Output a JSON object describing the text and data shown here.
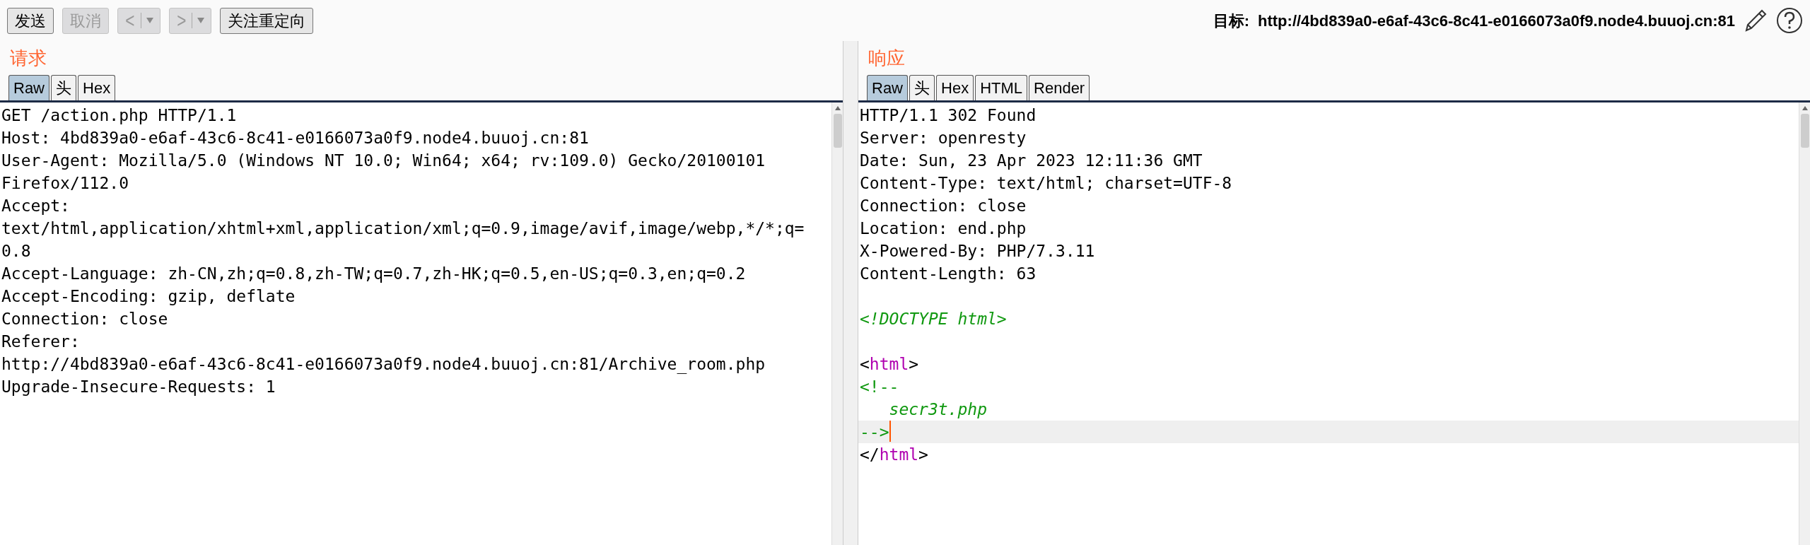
{
  "toolbar": {
    "buttons": [
      {
        "kind": "text",
        "label": "发送",
        "disabled": false
      },
      {
        "kind": "text",
        "label": "取消",
        "disabled": true
      },
      {
        "kind": "nav",
        "glyph": "<",
        "disabled": true
      },
      {
        "kind": "nav",
        "glyph": ">",
        "disabled": true
      },
      {
        "kind": "text",
        "label": "关注重定向",
        "disabled": false
      }
    ],
    "target_label": "目标:",
    "target_url": "http://4bd839a0-e6af-43c6-8c41-e0166073a0f9.node4.buuoj.cn:81"
  },
  "request": {
    "title": "请求",
    "tabs": [
      {
        "label": "Raw",
        "selected": true
      },
      {
        "label": "头",
        "selected": false
      },
      {
        "label": "Hex",
        "selected": false
      }
    ],
    "lines": [
      {
        "text": "GET /action.php HTTP/1.1"
      },
      {
        "text": "Host: 4bd839a0-e6af-43c6-8c41-e0166073a0f9.node4.buuoj.cn:81"
      },
      {
        "text": "User-Agent: Mozilla/5.0 (Windows NT 10.0; Win64; x64; rv:109.0) Gecko/20100101"
      },
      {
        "text": "Firefox/112.0"
      },
      {
        "text": "Accept:"
      },
      {
        "text": "text/html,application/xhtml+xml,application/xml;q=0.9,image/avif,image/webp,*/*;q="
      },
      {
        "text": "0.8"
      },
      {
        "text": "Accept-Language: zh-CN,zh;q=0.8,zh-TW;q=0.7,zh-HK;q=0.5,en-US;q=0.3,en;q=0.2"
      },
      {
        "text": "Accept-Encoding: gzip, deflate"
      },
      {
        "text": "Connection: close"
      },
      {
        "text": "Referer:"
      },
      {
        "text": "http://4bd839a0-e6af-43c6-8c41-e0166073a0f9.node4.buuoj.cn:81/Archive_room.php"
      },
      {
        "text": "Upgrade-Insecure-Requests: 1"
      }
    ]
  },
  "response": {
    "title": "响应",
    "tabs": [
      {
        "label": "Raw",
        "selected": true
      },
      {
        "label": "头",
        "selected": false
      },
      {
        "label": "Hex",
        "selected": false
      },
      {
        "label": "HTML",
        "selected": false
      },
      {
        "label": "Render",
        "selected": false
      }
    ],
    "lines": [
      {
        "kind": "code",
        "current": false,
        "parts": [
          {
            "kind": "text",
            "text": "HTTP/1.1 302 Found"
          }
        ]
      },
      {
        "kind": "code",
        "current": false,
        "parts": [
          {
            "kind": "text",
            "text": "Server: openresty"
          }
        ]
      },
      {
        "kind": "code",
        "current": false,
        "parts": [
          {
            "kind": "text",
            "text": "Date: Sun, 23 Apr 2023 12:11:36 GMT"
          }
        ]
      },
      {
        "kind": "code",
        "current": false,
        "parts": [
          {
            "kind": "text",
            "text": "Content-Type: text/html; charset=UTF-8"
          }
        ]
      },
      {
        "kind": "code",
        "current": false,
        "parts": [
          {
            "kind": "text",
            "text": "Connection: close"
          }
        ]
      },
      {
        "kind": "code",
        "current": false,
        "parts": [
          {
            "kind": "text",
            "text": "Location: end.php"
          }
        ]
      },
      {
        "kind": "code",
        "current": false,
        "parts": [
          {
            "kind": "text",
            "text": "X-Powered-By: PHP/7.3.11"
          }
        ]
      },
      {
        "kind": "code",
        "current": false,
        "parts": [
          {
            "kind": "text",
            "text": "Content-Length: 63"
          }
        ]
      },
      {
        "kind": "blank",
        "current": false
      },
      {
        "kind": "code",
        "current": false,
        "parts": [
          {
            "kind": "doctype",
            "text": "<!DOCTYPE html>"
          }
        ]
      },
      {
        "kind": "blank",
        "current": false
      },
      {
        "kind": "code",
        "current": false,
        "parts": [
          {
            "kind": "bracket",
            "text": "<"
          },
          {
            "kind": "tag",
            "text": "html"
          },
          {
            "kind": "bracket",
            "text": ">"
          }
        ]
      },
      {
        "kind": "code",
        "current": false,
        "parts": [
          {
            "kind": "comment",
            "text": "<!--"
          }
        ]
      },
      {
        "kind": "code",
        "current": false,
        "parts": [
          {
            "kind": "comment_italic",
            "text": "   secr3t.php"
          }
        ]
      },
      {
        "kind": "code",
        "current": true,
        "parts": [
          {
            "kind": "comment",
            "text": "-->"
          }
        ]
      },
      {
        "kind": "code",
        "current": false,
        "parts": [
          {
            "kind": "bracket",
            "text": "</"
          },
          {
            "kind": "tag",
            "text": "html"
          },
          {
            "kind": "bracket",
            "text": ">"
          }
        ]
      }
    ]
  }
}
